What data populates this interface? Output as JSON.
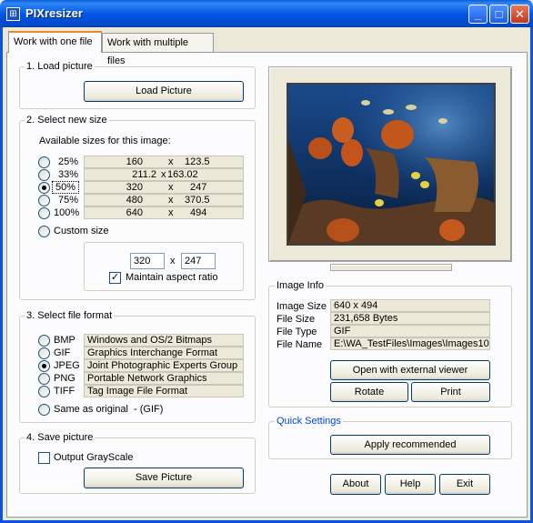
{
  "window": {
    "title": "PIXresizer",
    "icon": "app-icon",
    "buttons": {
      "minimize": "_",
      "maximize": "□",
      "close": "✕"
    }
  },
  "tabs": [
    {
      "label": "Work with one file",
      "active": true
    },
    {
      "label": "Work with multiple files",
      "active": false
    }
  ],
  "load": {
    "title": "1. Load picture",
    "button": "Load Picture"
  },
  "size": {
    "title": "2. Select new size",
    "caption": "Available sizes for this image:",
    "options": [
      {
        "pct": "25%",
        "w": "160",
        "x": "x",
        "h": "123.5",
        "checked": false
      },
      {
        "pct": "33%",
        "w": "211.2",
        "x": "x",
        "h": "163.02",
        "checked": false
      },
      {
        "pct": "50%",
        "w": "320",
        "x": "x",
        "h": "247",
        "checked": true
      },
      {
        "pct": "75%",
        "w": "480",
        "x": "x",
        "h": "370.5",
        "checked": false
      },
      {
        "pct": "100%",
        "w": "640",
        "x": "x",
        "h": "494",
        "checked": false
      }
    ],
    "custom_label": "Custom size",
    "custom_width": "320",
    "custom_x": "x",
    "custom_height": "247",
    "aspect_label": "Maintain aspect ratio",
    "aspect_checked": true
  },
  "format": {
    "title": "3. Select file format",
    "options": [
      {
        "name": "BMP",
        "desc": "Windows and OS/2 Bitmaps",
        "checked": false
      },
      {
        "name": "GIF",
        "desc": "Graphics Interchange Format",
        "checked": false
      },
      {
        "name": "JPEG",
        "desc": "Joint Photographic Experts Group",
        "checked": true
      },
      {
        "name": "PNG",
        "desc": "Portable Network Graphics",
        "checked": false
      },
      {
        "name": "TIFF",
        "desc": "Tag Image File Format",
        "checked": false
      }
    ],
    "same_as_original": "Same as original  - (GIF)"
  },
  "save": {
    "title": "4. Save picture",
    "grayscale_label": "Output GrayScale",
    "grayscale_checked": false,
    "button": "Save Picture"
  },
  "info": {
    "title": "Image Info",
    "rows": [
      {
        "label": "Image Size",
        "value": "640 x 494"
      },
      {
        "label": "File Size",
        "value": "231,658 Bytes"
      },
      {
        "label": "File Type",
        "value": "GIF"
      },
      {
        "label": "File Name",
        "value": "E:\\WA_TestFiles\\Images\\Images10."
      }
    ],
    "open_external": "Open with external viewer",
    "rotate": "Rotate",
    "print": "Print"
  },
  "quick": {
    "title": "Quick Settings",
    "apply": "Apply recommended"
  },
  "footer": {
    "about": "About",
    "help": "Help",
    "exit": "Exit"
  },
  "colors": {
    "titlebar": "#0055e3",
    "tab_highlight": "#e68b2c",
    "quick_settings_title": "#0046d5",
    "window_bg": "#ece9d8"
  }
}
